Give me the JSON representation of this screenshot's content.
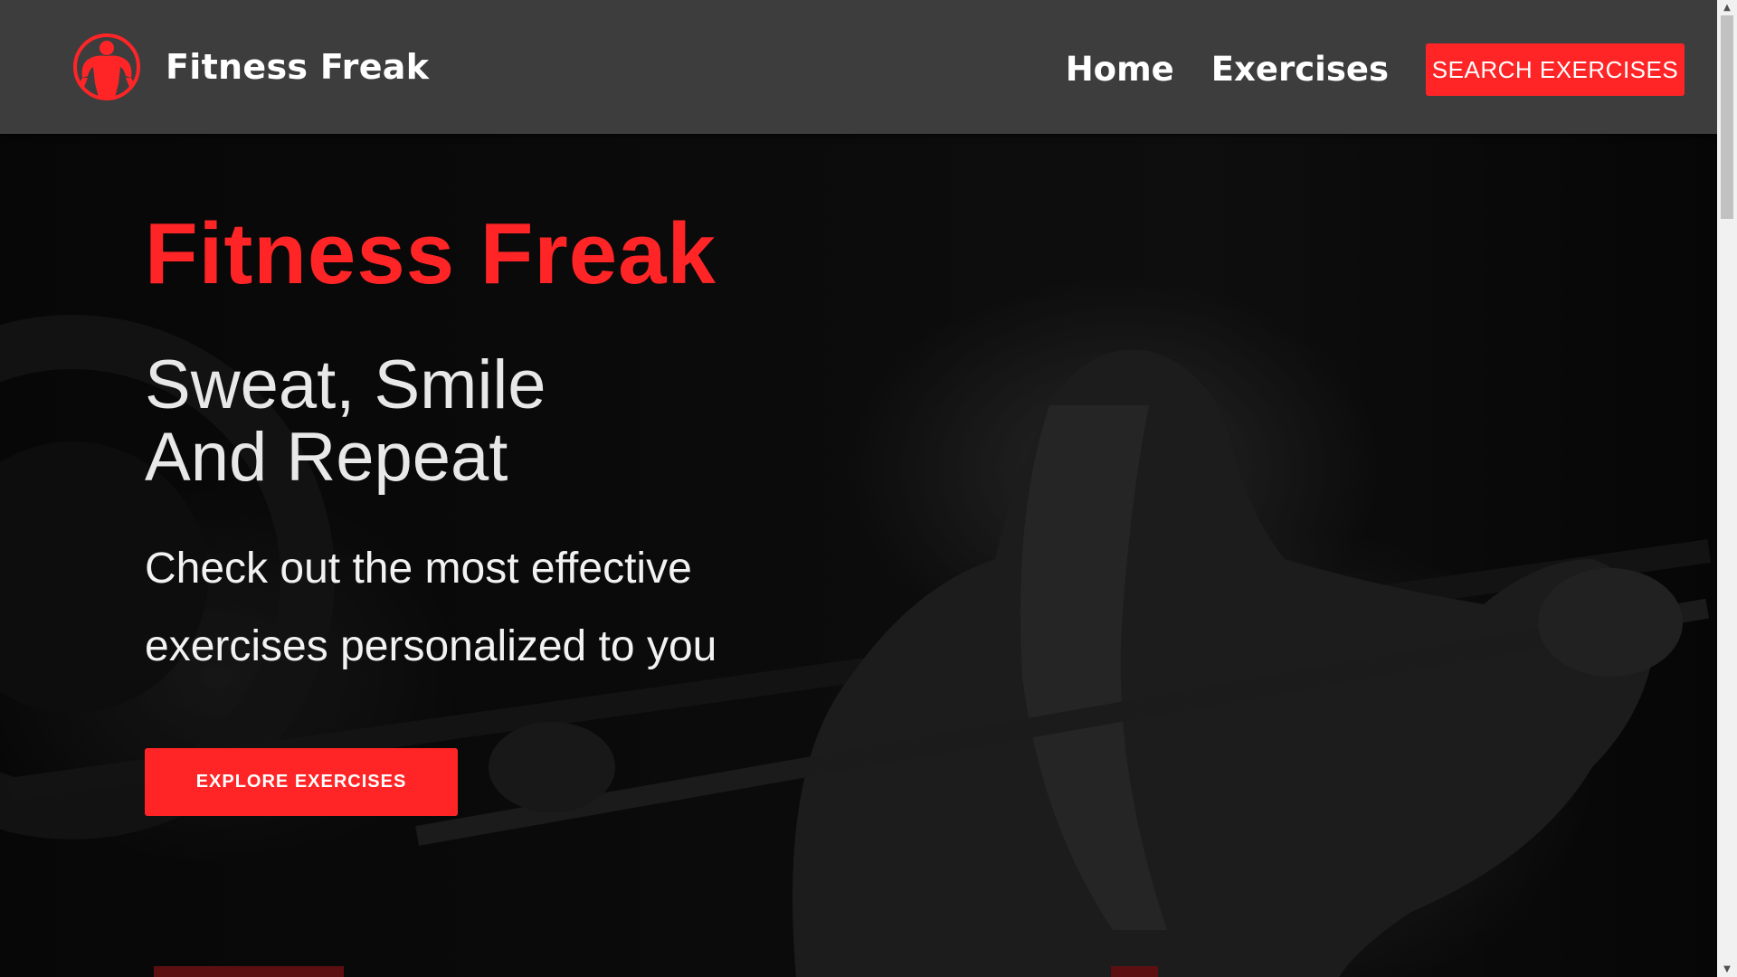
{
  "header": {
    "brand_name": "Fitness Freak",
    "logo_icon": "muscle-man-logo-icon",
    "nav_links": [
      {
        "label": "Home"
      },
      {
        "label": "Exercises"
      }
    ],
    "cta_label": "SEARCH EXERCISES"
  },
  "hero": {
    "title": "Fitness Freak",
    "tagline_line1": "Sweat, Smile",
    "tagline_line2": "And Repeat",
    "description": "Check out the most effective exercises personalized to you",
    "button_label": "EXPLORE EXERCISES",
    "background_image": "gym-barbell-squat-photo"
  },
  "colors": {
    "accent": "#ff2527",
    "header_bg": "#3e3d3e",
    "hero_bg": "#000000",
    "text_light": "#ffffff"
  }
}
